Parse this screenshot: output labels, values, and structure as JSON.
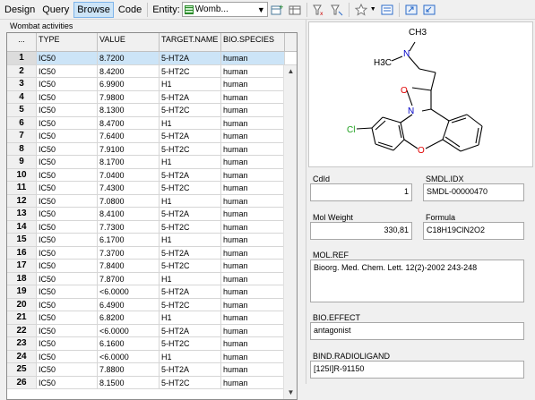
{
  "toolbar": {
    "design": "Design",
    "query": "Query",
    "browse": "Browse",
    "code": "Code",
    "entity_label": "Entity:",
    "entity_value": "Womb..."
  },
  "grid": {
    "title": "Wombat activities",
    "corner": "...",
    "columns": [
      "TYPE",
      "VALUE",
      "TARGET.NAME",
      "BIO.SPECIES"
    ],
    "rows": [
      [
        "1",
        "IC50",
        "8.7200",
        "5-HT2A",
        "human"
      ],
      [
        "2",
        "IC50",
        "8.4200",
        "5-HT2C",
        "human"
      ],
      [
        "3",
        "IC50",
        "6.9900",
        "H1",
        "human"
      ],
      [
        "4",
        "IC50",
        "7.9800",
        "5-HT2A",
        "human"
      ],
      [
        "5",
        "IC50",
        "8.1300",
        "5-HT2C",
        "human"
      ],
      [
        "6",
        "IC50",
        "8.4700",
        "H1",
        "human"
      ],
      [
        "7",
        "IC50",
        "7.6400",
        "5-HT2A",
        "human"
      ],
      [
        "8",
        "IC50",
        "7.9100",
        "5-HT2C",
        "human"
      ],
      [
        "9",
        "IC50",
        "8.1700",
        "H1",
        "human"
      ],
      [
        "10",
        "IC50",
        "7.0400",
        "5-HT2A",
        "human"
      ],
      [
        "11",
        "IC50",
        "7.4300",
        "5-HT2C",
        "human"
      ],
      [
        "12",
        "IC50",
        "7.0800",
        "H1",
        "human"
      ],
      [
        "13",
        "IC50",
        "8.4100",
        "5-HT2A",
        "human"
      ],
      [
        "14",
        "IC50",
        "7.7300",
        "5-HT2C",
        "human"
      ],
      [
        "15",
        "IC50",
        "6.1700",
        "H1",
        "human"
      ],
      [
        "16",
        "IC50",
        "7.3700",
        "5-HT2A",
        "human"
      ],
      [
        "17",
        "IC50",
        "7.8400",
        "5-HT2C",
        "human"
      ],
      [
        "18",
        "IC50",
        "7.8700",
        "H1",
        "human"
      ],
      [
        "19",
        "IC50",
        "<6.0000",
        "5-HT2A",
        "human"
      ],
      [
        "20",
        "IC50",
        "6.4900",
        "5-HT2C",
        "human"
      ],
      [
        "21",
        "IC50",
        "6.8200",
        "H1",
        "human"
      ],
      [
        "22",
        "IC50",
        "<6.0000",
        "5-HT2A",
        "human"
      ],
      [
        "23",
        "IC50",
        "6.1600",
        "5-HT2C",
        "human"
      ],
      [
        "24",
        "IC50",
        "<6.0000",
        "H1",
        "human"
      ],
      [
        "25",
        "IC50",
        "7.8800",
        "5-HT2A",
        "human"
      ],
      [
        "26",
        "IC50",
        "8.1500",
        "5-HT2C",
        "human"
      ]
    ]
  },
  "fields": {
    "cdid_label": "CdId",
    "cdid_value": "1",
    "smdl_label": "SMDL.IDX",
    "smdl_value": "SMDL-00000470",
    "molweight_label": "Mol Weight",
    "molweight_value": "330,81",
    "formula_label": "Formula",
    "formula_value": "C18H19ClN2O2",
    "molref_label": "MOL.REF",
    "molref_value": "Bioorg. Med. Chem. Lett. 12(2)-2002 243-248",
    "bioeffect_label": "BIO.EFFECT",
    "bioeffect_value": "antagonist",
    "radioligand_label": "BIND.RADIOLIGAND",
    "radioligand_value": "[125I]R-91150"
  },
  "molecule": {
    "atom_N_top": "N",
    "atom_N_ring": "N",
    "atom_O_ring": "O",
    "atom_O_bottom": "O",
    "atom_Cl": "Cl",
    "methyl_top": "CH3",
    "methyl_left": "H3C"
  },
  "colors": {
    "selection": "#cce4f7",
    "nitrogen": "#0000c8",
    "oxygen": "#e00000",
    "chlorine": "#1ea01e"
  }
}
